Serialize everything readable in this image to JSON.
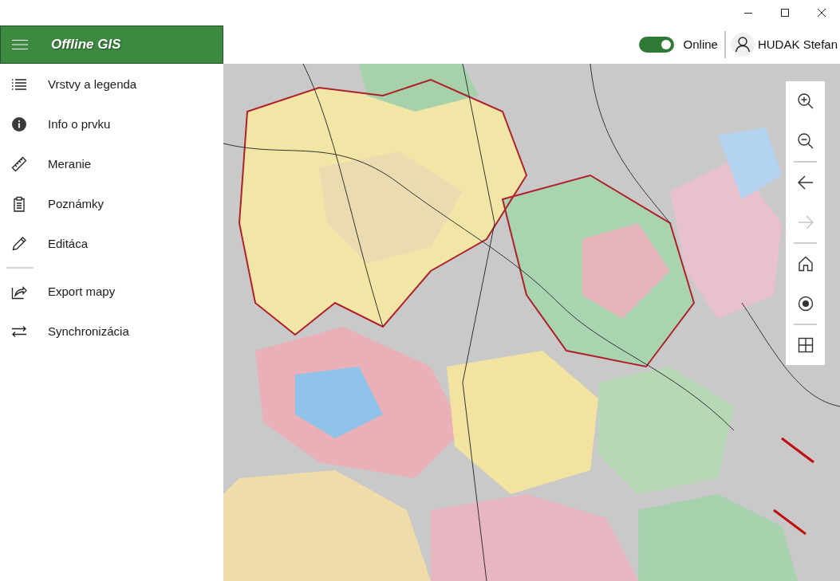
{
  "app_bar": {
    "title": "Offline GIS"
  },
  "connection": {
    "label": "Online",
    "on": true
  },
  "user": {
    "name": "HUDAK Stefan"
  },
  "menu": {
    "sections": [
      [
        {
          "label": "Vrstvy a legenda"
        },
        {
          "label": "Info o prvku"
        },
        {
          "label": "Meranie"
        },
        {
          "label": "Poznámky"
        },
        {
          "label": "Editáca"
        }
      ],
      [
        {
          "label": "Export mapy"
        },
        {
          "label": "Synchronizácia"
        }
      ]
    ]
  },
  "map_tools": {
    "groups": [
      [
        {
          "disabled": false
        },
        {
          "disabled": false
        }
      ],
      [
        {
          "disabled": false
        },
        {
          "disabled": true
        }
      ],
      [
        {
          "disabled": false
        },
        {
          "disabled": false
        }
      ],
      [
        {
          "disabled": false
        }
      ]
    ]
  }
}
